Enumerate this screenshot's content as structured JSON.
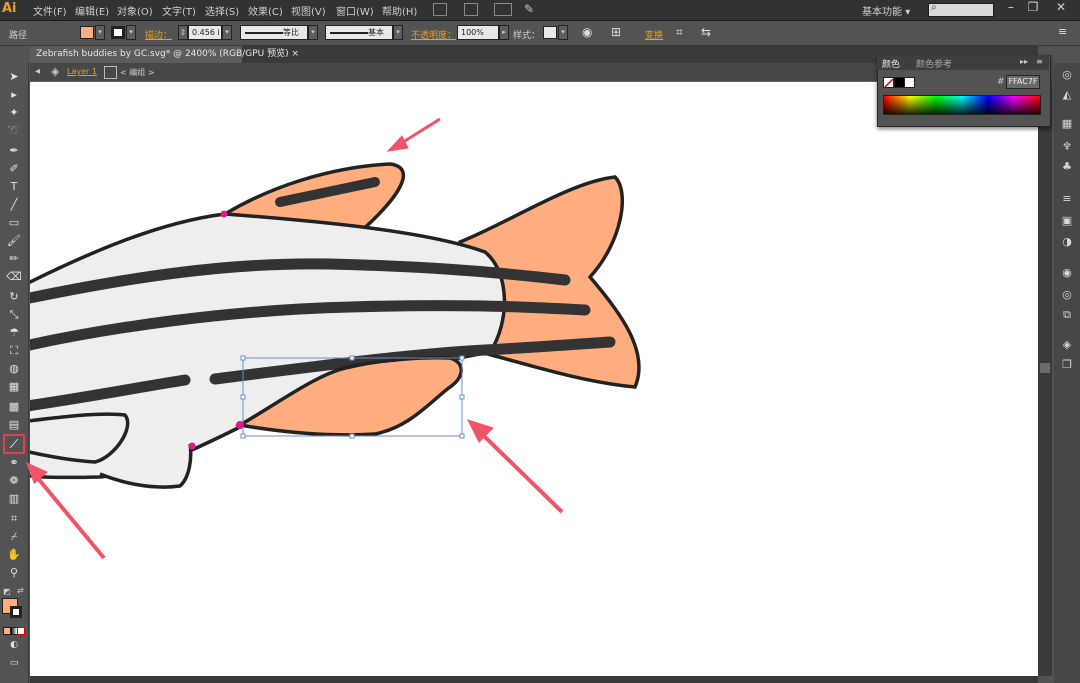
{
  "app": {
    "logo": "Ai"
  },
  "menus": [
    "文件(F)",
    "编辑(E)",
    "对象(O)",
    "文字(T)",
    "选择(S)",
    "效果(C)",
    "视图(V)",
    "窗口(W)",
    "帮助(H)"
  ],
  "workspace": {
    "label": "基本功能",
    "arrow": "▾"
  },
  "window_controls": {
    "minimize": "–",
    "restore": "❐",
    "close": "✕"
  },
  "control_bar": {
    "object_type": "路径",
    "stroke_label": "描边：",
    "stroke_weight": "0.456 i",
    "profile": "等比",
    "brush": "基本",
    "opacity_label": "不透明度：",
    "opacity_value": "100%",
    "style_label": "样式：",
    "transform_label": "变换",
    "fill_color": "#FFAC7F"
  },
  "document": {
    "tab_title": "Zebrafish buddies by GC.svg* @ 2400% (RGB/GPU 预览)",
    "tab_close": "×",
    "layer": "Layer 1",
    "group": "编组"
  },
  "color_panel": {
    "tab_active": "颜色",
    "tab_inactive": "颜色参考",
    "hex_sign": "#",
    "hex_value": "FFAC7F"
  },
  "colors": {
    "fin": "#FFAC7F",
    "body": "#EEEEEE",
    "stripe": "#333333",
    "outline": "#222222",
    "anchor": "#E0198A",
    "arrow": "#F05466",
    "selection": "#6C8CD5"
  },
  "tools": [
    "selection-tool",
    "direct-selection-tool",
    "magic-wand-tool",
    "lasso-tool",
    "pen-tool",
    "curvature-tool",
    "type-tool",
    "line-tool",
    "rectangle-tool",
    "paintbrush-tool",
    "pencil-tool",
    "eraser-tool",
    "rotate-tool",
    "scale-tool",
    "warp-tool",
    "free-transform-tool",
    "shape-builder-tool",
    "perspective-grid-tool",
    "mesh-tool",
    "gradient-tool",
    "eyedropper-tool",
    "blend-tool",
    "symbol-sprayer-tool",
    "column-graph-tool",
    "artboard-tool",
    "slice-tool",
    "hand-tool",
    "zoom-tool"
  ]
}
